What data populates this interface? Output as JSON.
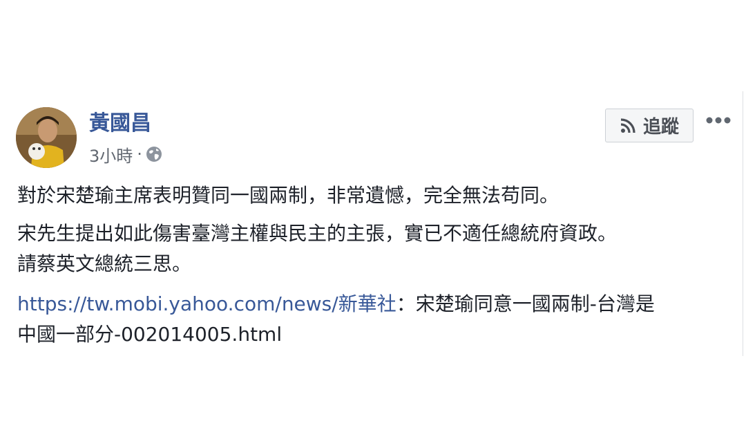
{
  "post": {
    "author": "黃國昌",
    "time": "3小時",
    "separator": "·",
    "privacy_icon": "globe-icon",
    "follow_label": "追蹤",
    "follow_icon": "rss-icon",
    "more_icon": "more-dots-icon",
    "paragraphs": [
      "對於宋楚瑜主席表明贊同一國兩制，非常遺憾，完全無法苟同。",
      "宋先生提出如此傷害臺灣主權與民主的主張，實已不適任總統府資政。",
      "請蔡英文總統三思。"
    ],
    "link_url": "https://tw.mobi.yahoo.com/news/新華社",
    "link_rest_line1": "：宋楚瑜同意一國兩制-台灣是",
    "link_rest_line2": "中國一部分-002014005.html"
  },
  "colors": {
    "link": "#385898",
    "text": "#1d2129",
    "meta": "#616770",
    "button_bg": "#f5f6f7",
    "button_border": "#ccd0d5"
  }
}
